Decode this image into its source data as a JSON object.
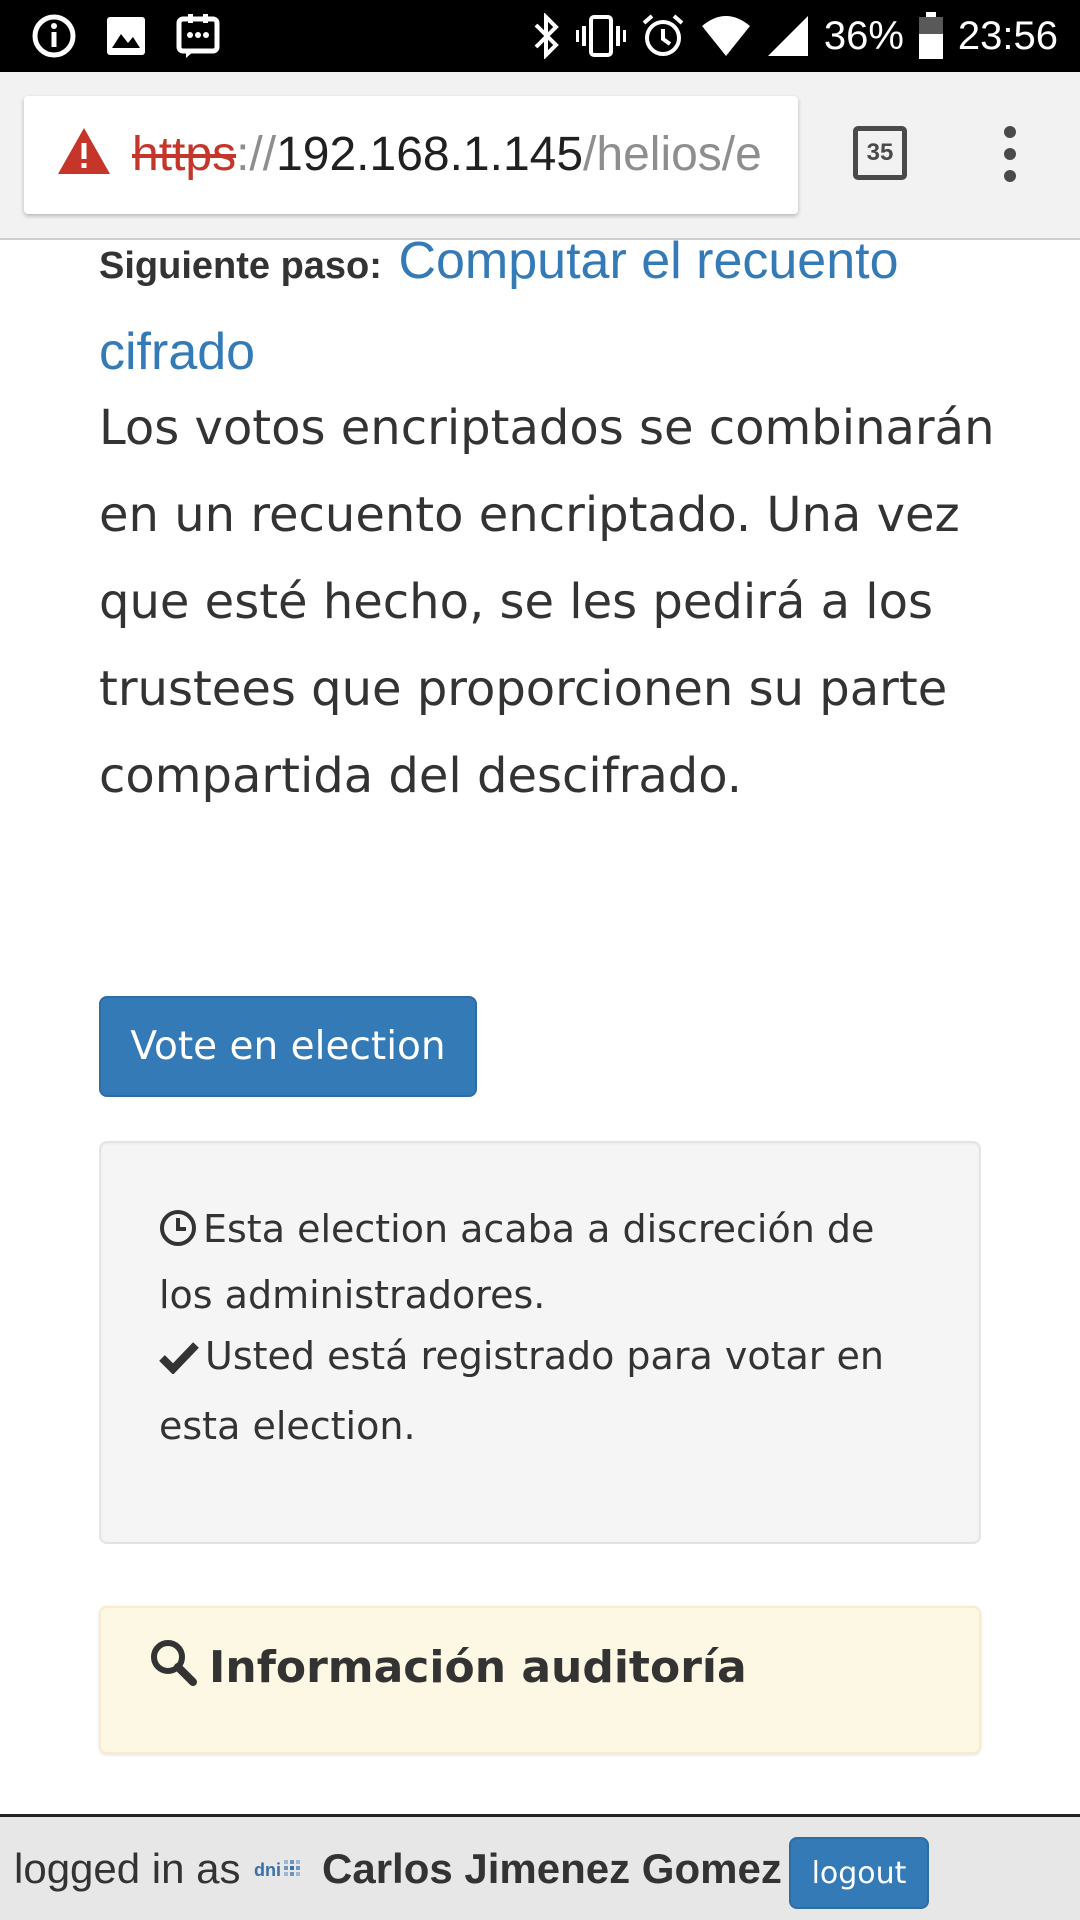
{
  "status_bar": {
    "battery": "36%",
    "time": "23:56",
    "left_icons": [
      "info-icon",
      "image-icon",
      "messenger-icon"
    ],
    "right_icons": [
      "bluetooth-icon",
      "vibrate-icon",
      "alarm-icon",
      "wifi-icon",
      "signal-icon",
      "battery-icon"
    ]
  },
  "browser": {
    "url_scheme": "https",
    "url_separator": "://",
    "url_host": "192.168.1.145",
    "url_path": "/helios/e",
    "tab_count": "35",
    "security_state_icon": "warning-triangle-icon",
    "warning_color": "#c5352a"
  },
  "content": {
    "next_step_label": "Siguiente paso:",
    "next_step_link": "Computar el recuento cifrado",
    "description": "Los votos encriptados se combinarán en un recuento encriptado. Una vez que esté hecho, se les pedirá a los trustees que proporcionen su parte compartida del descifrado.",
    "vote_button": "Vote en election",
    "end_info": "Esta election acaba a discreción de los administradores.",
    "registered_info": "Usted está registrado para votar en esta election.",
    "audit_title": "Información auditoría"
  },
  "footer": {
    "logged_in_label": "logged in as",
    "logo_text": "dni",
    "user_name": "Carlos Jimenez Gomez",
    "logout_label": "logout"
  },
  "colors": {
    "link": "#337ab7",
    "primary_button": "#337ab7",
    "well_background": "#f5f5f5",
    "audit_background": "#fcf8e3"
  }
}
